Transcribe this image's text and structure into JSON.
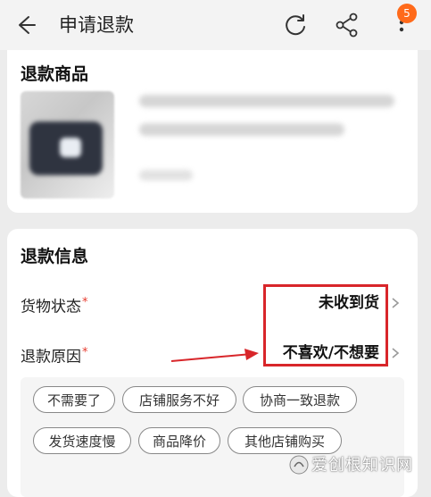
{
  "header": {
    "title": "申请退款",
    "notification_count": "5",
    "icons": [
      "back-arrow-icon",
      "refresh-icon",
      "share-icon",
      "more-icon"
    ]
  },
  "refund_item": {
    "section_title": "退款商品"
  },
  "refund_info": {
    "section_title": "退款信息",
    "goods_status": {
      "label": "货物状态",
      "required_mark": "*",
      "value": "未收到货"
    },
    "refund_reason": {
      "label": "退款原因",
      "required_mark": "*",
      "value": "不喜欢/不想要"
    },
    "reason_options": [
      "不需要了",
      "店铺服务不好",
      "协商一致退款",
      "发货速度慢",
      "商品降价",
      "其他店铺购买"
    ]
  },
  "annotation": {
    "box_color": "#d8262a"
  },
  "colors": {
    "accent": "#ff6a1a",
    "required": "#e63b2e"
  },
  "watermark": {
    "text": "爱创根知识网"
  }
}
